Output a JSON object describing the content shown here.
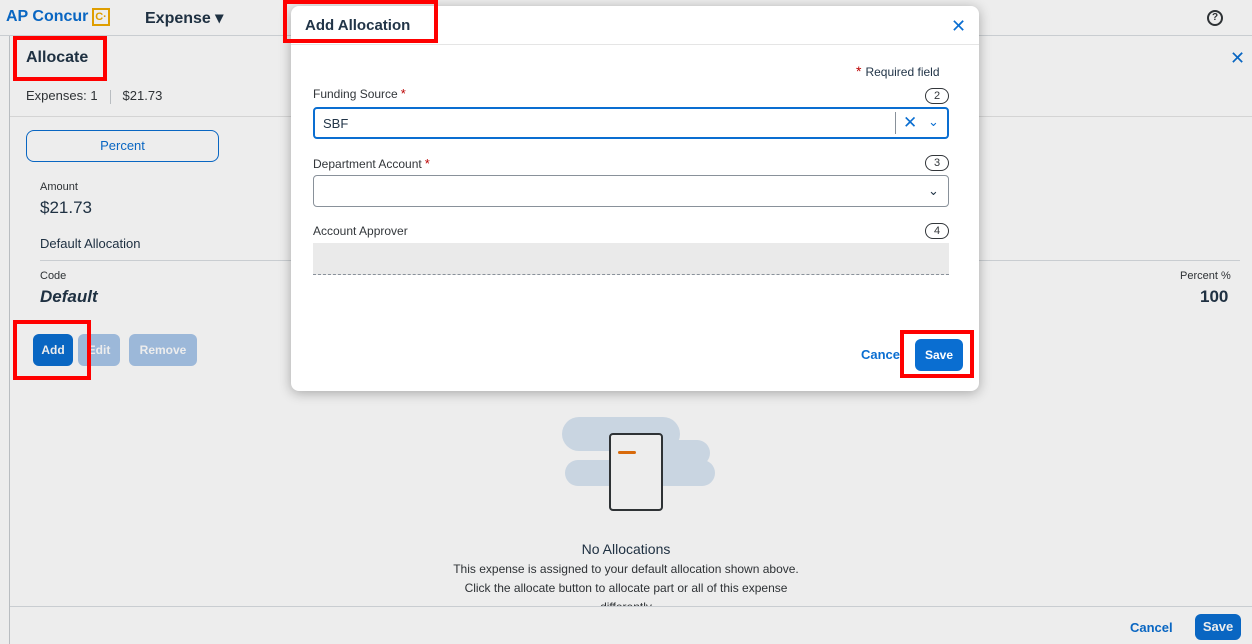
{
  "topbar": {
    "brand": "AP Concur",
    "brand_mark": "C·",
    "nav_expense": "Expense ▾",
    "help_glyph": "?"
  },
  "panel": {
    "title": "Allocate",
    "close_glyph": "✕",
    "expenses_label": "Expenses: 1",
    "expenses_total": "$21.73",
    "percent_tab": "Percent",
    "amount_label": "Amount",
    "amount_value": "$21.73",
    "default_allocation": "Default Allocation",
    "code_label": "Code",
    "code_value": "Default",
    "percent_label": "Percent %",
    "percent_value": "100",
    "add_button": "Add",
    "edit_button": "Edit",
    "remove_button": "Remove",
    "empty_title": "No Allocations",
    "empty_line1": "This expense is assigned to your default allocation shown above.",
    "empty_line2": "Click the allocate button to allocate part or all of this expense",
    "empty_line3": "differently",
    "footer_cancel": "Cancel",
    "footer_save": "Save"
  },
  "modal": {
    "title": "Add Allocation",
    "close_glyph": "✕",
    "required_star": "*",
    "required_note": "Required field",
    "fields": [
      {
        "label": "Funding Source",
        "required": "*",
        "step": "2",
        "value": "SBF"
      },
      {
        "label": "Department Account",
        "required": "*",
        "step": "3",
        "value": ""
      },
      {
        "label": "Account Approver",
        "step": "4",
        "value": ""
      }
    ],
    "clear_glyph": "✕",
    "chevron_glyph": "⌄",
    "cancel_button": "Cance",
    "save_button": "Save"
  },
  "colors": {
    "accent": "#0a6ed1",
    "required": "#bb0000",
    "highlight": "#ff0000"
  }
}
